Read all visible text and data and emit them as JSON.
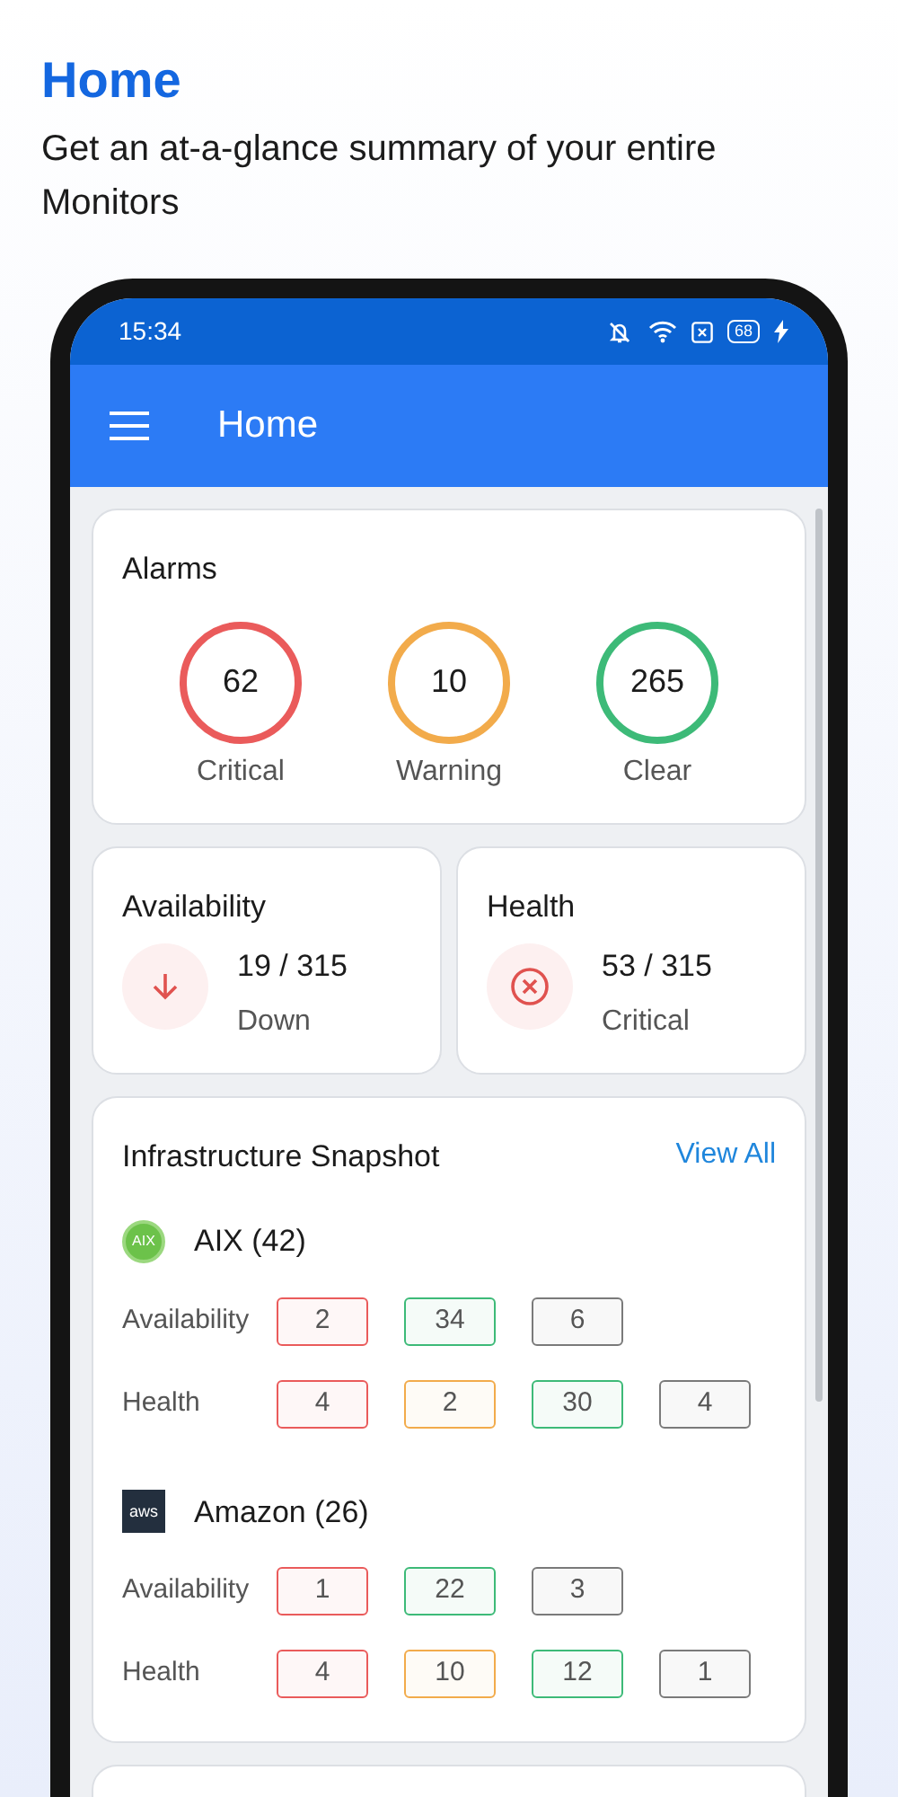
{
  "page": {
    "title": "Home",
    "subtitle": "Get an at-a-glance summary of your entire Monitors"
  },
  "status_bar": {
    "time": "15:34",
    "battery": "68"
  },
  "app_bar": {
    "title": "Home"
  },
  "alarms": {
    "title": "Alarms",
    "items": [
      {
        "count": "62",
        "label": "Critical",
        "color": "#ea5b5b"
      },
      {
        "count": "10",
        "label": "Warning",
        "color": "#f2ab4b"
      },
      {
        "count": "265",
        "label": "Clear",
        "color": "#3dba78"
      }
    ]
  },
  "summaries": [
    {
      "kind": "down",
      "title": "Availability",
      "value": "19 / 315",
      "label": "Down"
    },
    {
      "kind": "critical",
      "title": "Health",
      "value": "53 / 315",
      "label": "Critical"
    }
  ],
  "snapshot": {
    "title": "Infrastructure Snapshot",
    "link": "View All",
    "groups": [
      {
        "kind": "aix",
        "logo_text": "AIX",
        "name": "AIX (42)",
        "rows": [
          {
            "label": "Availability",
            "chips": [
              {
                "value": "2",
                "color": "#ea5b5b"
              },
              {
                "value": "34",
                "color": "#3dba78"
              },
              {
                "value": "6",
                "color": "#7a7a7a"
              }
            ]
          },
          {
            "label": "Health",
            "chips": [
              {
                "value": "4",
                "color": "#ea5b5b"
              },
              {
                "value": "2",
                "color": "#f2ab4b"
              },
              {
                "value": "30",
                "color": "#3dba78"
              },
              {
                "value": "4",
                "color": "#7a7a7a"
              }
            ]
          }
        ]
      },
      {
        "kind": "aws",
        "logo_text": "aws",
        "name": "Amazon (26)",
        "rows": [
          {
            "label": "Availability",
            "chips": [
              {
                "value": "1",
                "color": "#ea5b5b"
              },
              {
                "value": "22",
                "color": "#3dba78"
              },
              {
                "value": "3",
                "color": "#7a7a7a"
              }
            ]
          },
          {
            "label": "Health",
            "chips": [
              {
                "value": "4",
                "color": "#ea5b5b"
              },
              {
                "value": "10",
                "color": "#f2ab4b"
              },
              {
                "value": "12",
                "color": "#3dba78"
              },
              {
                "value": "1",
                "color": "#7a7a7a"
              }
            ]
          }
        ]
      }
    ]
  }
}
